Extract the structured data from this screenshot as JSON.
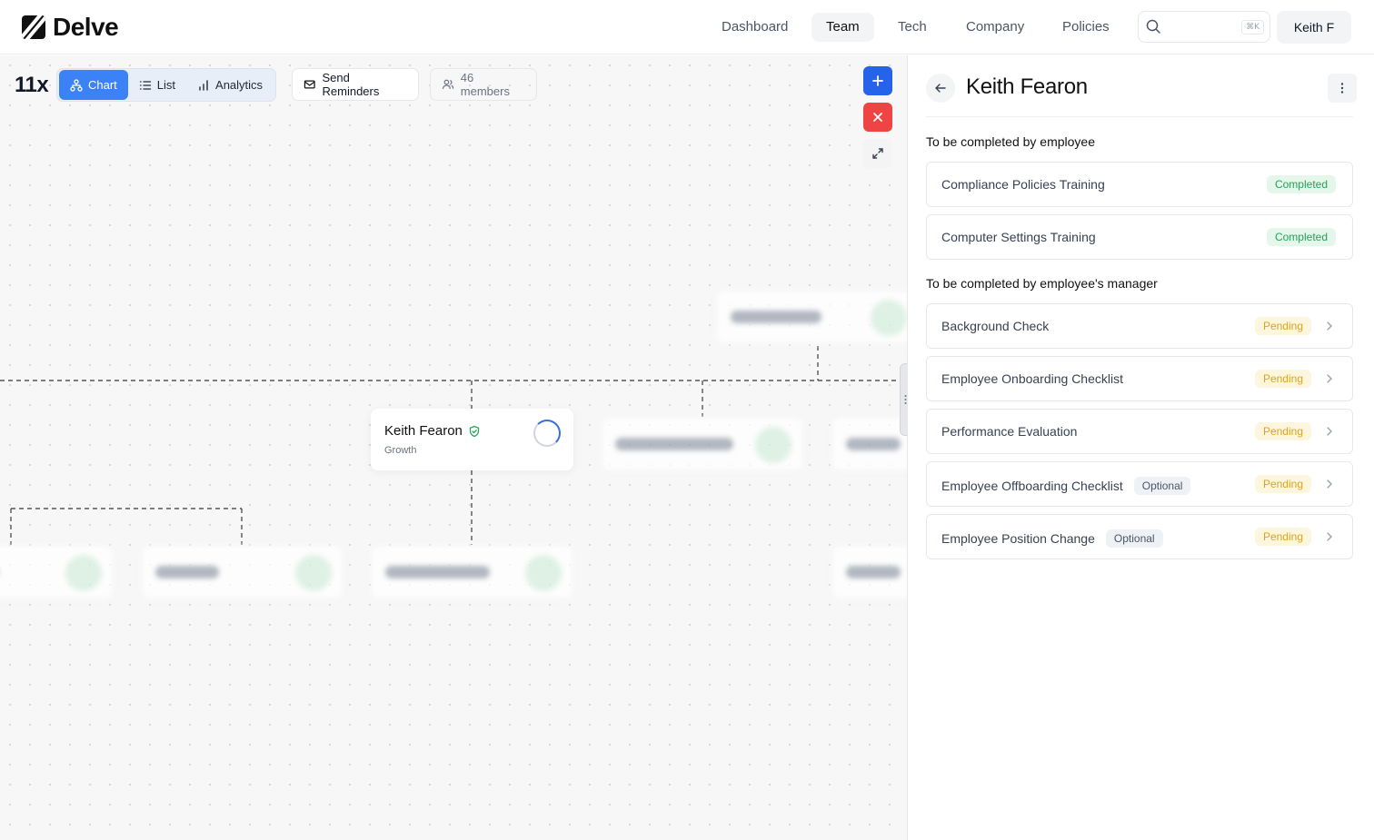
{
  "brand": {
    "name": "Delve"
  },
  "nav": {
    "items": [
      {
        "label": "Dashboard",
        "active": false
      },
      {
        "label": "Team",
        "active": true
      },
      {
        "label": "Tech",
        "active": false
      },
      {
        "label": "Company",
        "active": false
      },
      {
        "label": "Policies",
        "active": false
      }
    ],
    "search_shortcut": "⌘K",
    "user": "Keith F"
  },
  "toolbar": {
    "org": "11x",
    "views": [
      "Chart",
      "List",
      "Analytics"
    ],
    "active_view": "Chart",
    "send_reminders": "Send Reminders",
    "members": "46 members"
  },
  "chart": {
    "focus": {
      "name": "Keith Fearon",
      "dept": "Growth"
    }
  },
  "panel": {
    "title": "Keith Fearon",
    "employee_section": "To be completed by employee",
    "employee_tasks": [
      {
        "name": "Compliance Policies Training",
        "status": "Completed"
      },
      {
        "name": "Computer Settings Training",
        "status": "Completed"
      }
    ],
    "manager_section": "To be completed by employee's manager",
    "manager_tasks": [
      {
        "name": "Background Check",
        "status": "Pending",
        "optional": ""
      },
      {
        "name": "Employee Onboarding Checklist",
        "status": "Pending",
        "optional": ""
      },
      {
        "name": "Performance Evaluation",
        "status": "Pending",
        "optional": ""
      },
      {
        "name": "Employee Offboarding Checklist",
        "status": "Pending",
        "optional": "Optional"
      },
      {
        "name": "Employee Position Change",
        "status": "Pending",
        "optional": "Optional"
      }
    ]
  },
  "colors": {
    "accent": "#3b82f6",
    "danger": "#ef4444",
    "completed": "#22a35a",
    "pending": "#e0a317"
  }
}
